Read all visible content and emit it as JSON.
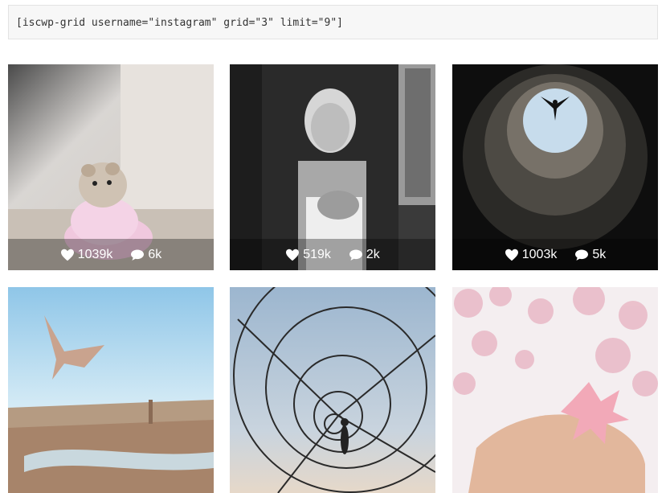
{
  "shortcode": "[iscwp-grid username=\"instagram\" grid=\"3\" limit=\"9\"]",
  "posts": [
    {
      "likes": "1039k",
      "comments": "6k",
      "subject": "hamster in pink dress"
    },
    {
      "likes": "519k",
      "comments": "2k",
      "subject": "elderly woman black and white portrait"
    },
    {
      "likes": "1003k",
      "comments": "5k",
      "subject": "person silhouette above circular tower opening"
    },
    {
      "likes": "",
      "comments": "",
      "subject": "paper crane over city"
    },
    {
      "likes": "",
      "comments": "",
      "subject": "child walking on spiral sculpture"
    },
    {
      "likes": "",
      "comments": "",
      "subject": "paper flower on hand with cherry blossoms"
    }
  ],
  "icons": {
    "like": "heart-icon",
    "comment": "comment-bubble-icon"
  }
}
